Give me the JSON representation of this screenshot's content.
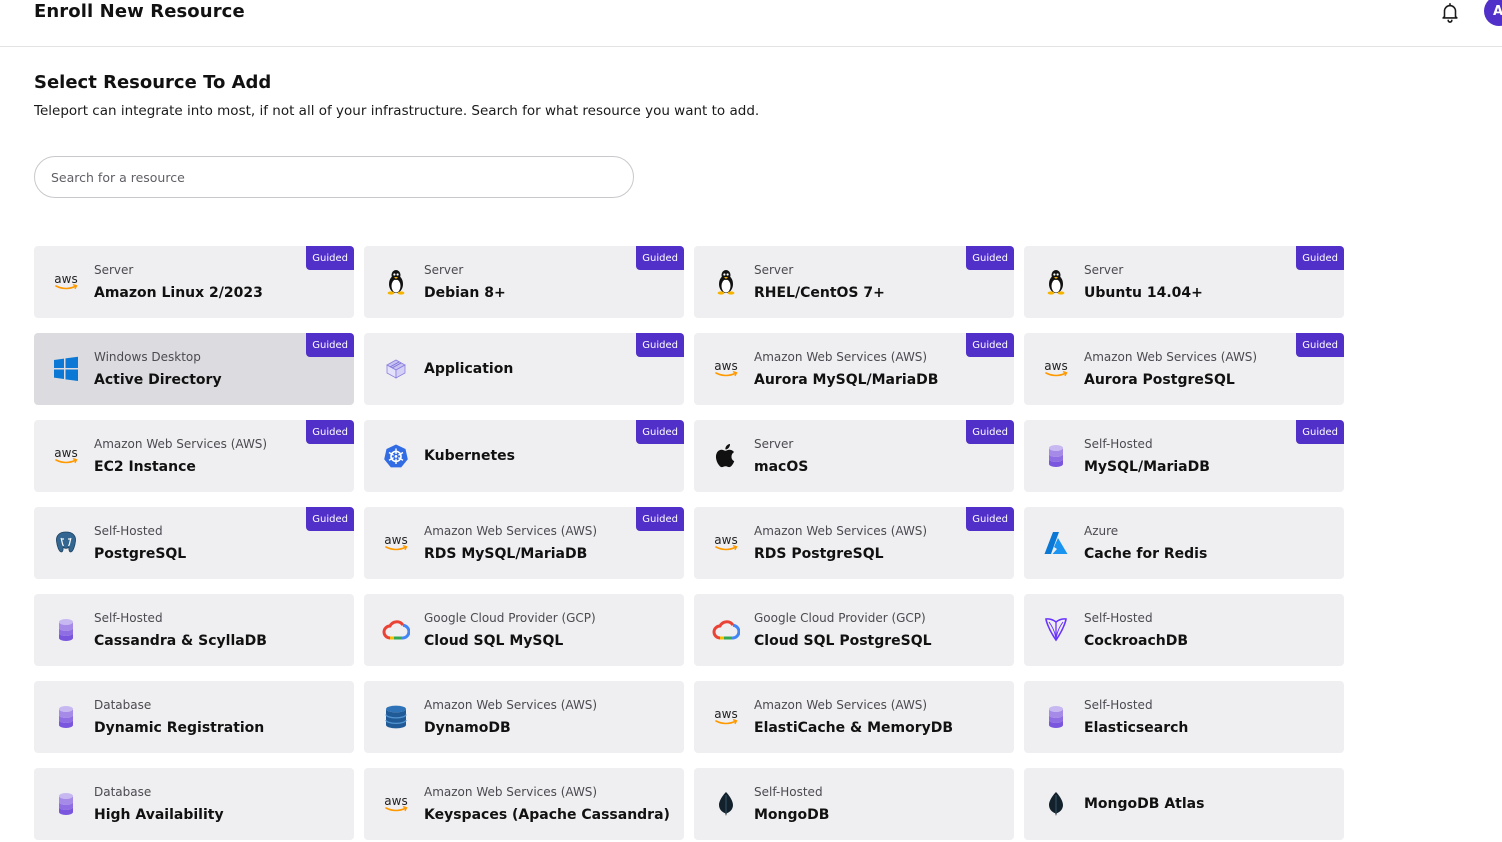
{
  "header": {
    "title": "Enroll New Resource",
    "avatar_initial": "A"
  },
  "main": {
    "heading": "Select Resource To Add",
    "subheading": "Teleport can integrate into most, if not all of your infrastructure. Search for what resource you want to add.",
    "search_placeholder": "Search for a resource"
  },
  "resources": [
    {
      "kind": "Server",
      "name": "Amazon Linux 2/2023",
      "icon": "aws",
      "badge": "Guided"
    },
    {
      "kind": "Server",
      "name": "Debian 8+",
      "icon": "linux",
      "badge": "Guided"
    },
    {
      "kind": "Server",
      "name": "RHEL/CentOS 7+",
      "icon": "linux",
      "badge": "Guided"
    },
    {
      "kind": "Server",
      "name": "Ubuntu 14.04+",
      "icon": "linux",
      "badge": "Guided"
    },
    {
      "kind": "Windows Desktop",
      "name": "Active Directory",
      "icon": "windows",
      "badge": "Guided",
      "selected": true
    },
    {
      "kind": "",
      "name": "Application",
      "icon": "application",
      "badge": "Guided"
    },
    {
      "kind": "Amazon Web Services (AWS)",
      "name": "Aurora MySQL/MariaDB",
      "icon": "aws",
      "badge": "Guided"
    },
    {
      "kind": "Amazon Web Services (AWS)",
      "name": "Aurora PostgreSQL",
      "icon": "aws",
      "badge": "Guided"
    },
    {
      "kind": "Amazon Web Services (AWS)",
      "name": "EC2 Instance",
      "icon": "aws",
      "badge": "Guided"
    },
    {
      "kind": "",
      "name": "Kubernetes",
      "icon": "kubernetes",
      "badge": "Guided"
    },
    {
      "kind": "Server",
      "name": "macOS",
      "icon": "apple",
      "badge": "Guided"
    },
    {
      "kind": "Self-Hosted",
      "name": "MySQL/MariaDB",
      "icon": "database",
      "badge": "Guided"
    },
    {
      "kind": "Self-Hosted",
      "name": "PostgreSQL",
      "icon": "postgres",
      "badge": "Guided"
    },
    {
      "kind": "Amazon Web Services (AWS)",
      "name": "RDS MySQL/MariaDB",
      "icon": "aws",
      "badge": "Guided"
    },
    {
      "kind": "Amazon Web Services (AWS)",
      "name": "RDS PostgreSQL",
      "icon": "aws",
      "badge": "Guided"
    },
    {
      "kind": "Azure",
      "name": "Cache for Redis",
      "icon": "azure",
      "badge": ""
    },
    {
      "kind": "Self-Hosted",
      "name": "Cassandra & ScyllaDB",
      "icon": "database",
      "badge": ""
    },
    {
      "kind": "Google Cloud Provider (GCP)",
      "name": "Cloud SQL MySQL",
      "icon": "gcp",
      "badge": ""
    },
    {
      "kind": "Google Cloud Provider (GCP)",
      "name": "Cloud SQL PostgreSQL",
      "icon": "gcp",
      "badge": ""
    },
    {
      "kind": "Self-Hosted",
      "name": "CockroachDB",
      "icon": "cockroach",
      "badge": ""
    },
    {
      "kind": "Database",
      "name": "Dynamic Registration",
      "icon": "database",
      "badge": ""
    },
    {
      "kind": "Amazon Web Services (AWS)",
      "name": "DynamoDB",
      "icon": "dynamodb",
      "badge": ""
    },
    {
      "kind": "Amazon Web Services (AWS)",
      "name": "ElastiCache & MemoryDB",
      "icon": "aws",
      "badge": ""
    },
    {
      "kind": "Self-Hosted",
      "name": "Elasticsearch",
      "icon": "database",
      "badge": ""
    },
    {
      "kind": "Database",
      "name": "High Availability",
      "icon": "database",
      "badge": ""
    },
    {
      "kind": "Amazon Web Services (AWS)",
      "name": "Keyspaces (Apache Cassandra)",
      "icon": "aws",
      "badge": ""
    },
    {
      "kind": "Self-Hosted",
      "name": "MongoDB",
      "icon": "mongodb",
      "badge": ""
    },
    {
      "kind": "",
      "name": "MongoDB Atlas",
      "icon": "mongodb",
      "badge": ""
    }
  ],
  "icon_text": {
    "aws": "aws"
  },
  "colors": {
    "accent": "#512fc9",
    "card_bg": "#efeff1",
    "card_selected_bg": "#dcdce0"
  }
}
